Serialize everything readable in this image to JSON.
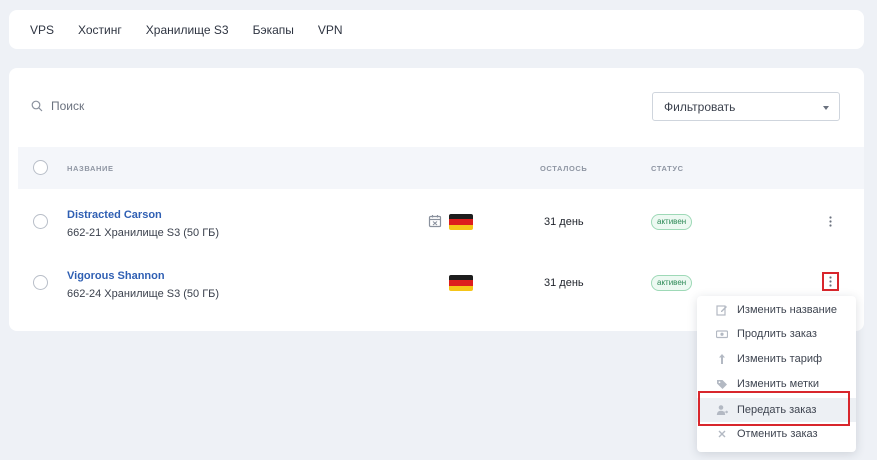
{
  "nav": {
    "tabs": [
      {
        "label": "VPS"
      },
      {
        "label": "Хостинг"
      },
      {
        "label": "Хранилище S3"
      },
      {
        "label": "Бэкапы"
      },
      {
        "label": "VPN"
      }
    ]
  },
  "search": {
    "placeholder": "Поиск"
  },
  "filter": {
    "label": "Фильтровать"
  },
  "table": {
    "headers": {
      "name": "НАЗВАНИЕ",
      "left": "ОСТАЛОСЬ",
      "status": "СТАТУС"
    },
    "rows": [
      {
        "name": "Distracted Carson",
        "sub": "662-21  Хранилище S3 (50 ГБ)",
        "days": "31 день",
        "status": "активен",
        "has_calendar_icon": true,
        "flag": "germany-flag-icon"
      },
      {
        "name": "Vigorous Shannon",
        "sub": "662-24  Хранилище S3 (50 ГБ)",
        "days": "31 день",
        "status": "активен",
        "has_calendar_icon": false,
        "flag": "germany-flag-icon"
      }
    ]
  },
  "menu": {
    "items": [
      {
        "label": "Изменить название",
        "icon": "edit-icon"
      },
      {
        "label": "Продлить заказ",
        "icon": "money-icon"
      },
      {
        "label": "Изменить тариф",
        "icon": "arrow-up-icon"
      },
      {
        "label": "Изменить метки",
        "icon": "tag-icon"
      },
      {
        "label": "Передать заказ",
        "icon": "transfer-user-icon"
      },
      {
        "label": "Отменить заказ",
        "icon": "close-icon"
      }
    ]
  },
  "colors": {
    "link": "#2f5fb3",
    "badge_text": "#2d8a57",
    "highlight_frame": "#d8262c",
    "background": "#eef1f6"
  }
}
